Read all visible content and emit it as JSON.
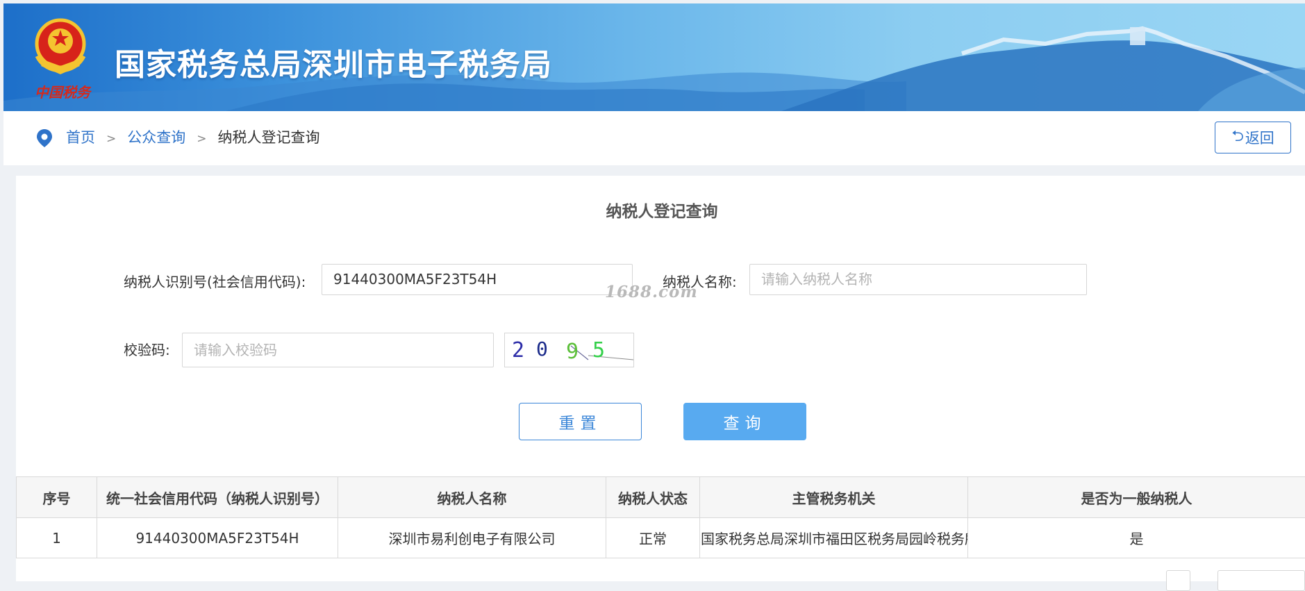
{
  "header": {
    "title": "国家税务总局深圳市电子税务局",
    "emblem_text": "中国税务"
  },
  "breadcrumb": {
    "home": "首页",
    "public_query": "公众查询",
    "current": "纳税人登记查询",
    "separator": ">"
  },
  "back_button": {
    "icon": "return-arrow-icon",
    "label": "返回"
  },
  "form": {
    "title": "纳税人登记查询",
    "taxpayer_id_label": "纳税人识别号(社会信用代码):",
    "taxpayer_id_value": "91440300MA5F23T54H",
    "taxpayer_name_label": "纳税人名称:",
    "taxpayer_name_placeholder": "请输入纳税人名称",
    "captcha_label": "校验码:",
    "captcha_placeholder": "请输入校验码",
    "captcha_text": [
      "2",
      "0",
      "9",
      "5"
    ],
    "reset_label": "重置",
    "query_label": "查询"
  },
  "watermark": "1688.com",
  "table": {
    "columns": [
      "序号",
      "统一社会信用代码（纳税人识别号）",
      "纳税人名称",
      "纳税人状态",
      "主管税务机关",
      "是否为一般纳税人"
    ],
    "rows": [
      [
        "1",
        "91440300MA5F23T54H",
        "深圳市易利创电子有限公司",
        "正常",
        "国家税务总局深圳市福田区税务局园岭税务所",
        "是"
      ]
    ]
  },
  "colors": {
    "link": "#2f73c9",
    "primary_button": "#58aaf0",
    "banner_dark": "#1d6fc9",
    "banner_light": "#9ad6f4"
  }
}
